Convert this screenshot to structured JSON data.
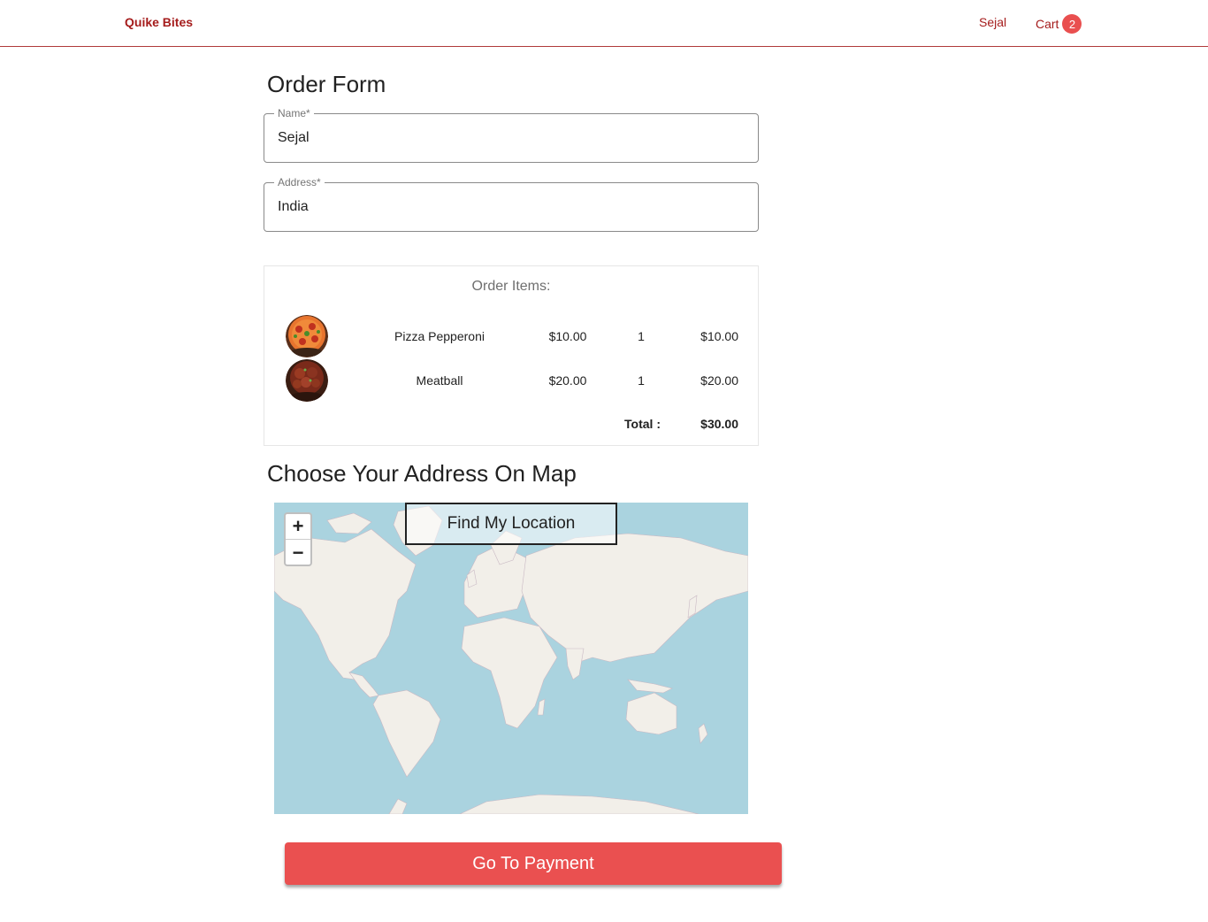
{
  "header": {
    "brand": "Quike Bites",
    "user": "Sejal",
    "cart_label": "Cart",
    "cart_count": "2"
  },
  "form": {
    "title": "Order Form",
    "name_label": "Name*",
    "name_value": "Sejal",
    "address_label": "Address*",
    "address_value": "India"
  },
  "order": {
    "heading": "Order Items:",
    "items": [
      {
        "name": "Pizza Pepperoni",
        "price": "$10.00",
        "qty": "1",
        "subtotal": "$10.00",
        "image": "pizza-image"
      },
      {
        "name": "Meatball",
        "price": "$20.00",
        "qty": "1",
        "subtotal": "$20.00",
        "image": "meatball-image"
      }
    ],
    "total_label": "Total :",
    "total_value": "$30.00"
  },
  "map": {
    "title": "Choose Your Address On Map",
    "zoom_in": "+",
    "zoom_out": "−",
    "find_label": "Find My Location"
  },
  "payment": {
    "button_label": "Go To Payment"
  },
  "colors": {
    "brand": "#a51c1c",
    "accent": "#ea5050",
    "water": "#aad3df",
    "land": "#f2efe9"
  }
}
